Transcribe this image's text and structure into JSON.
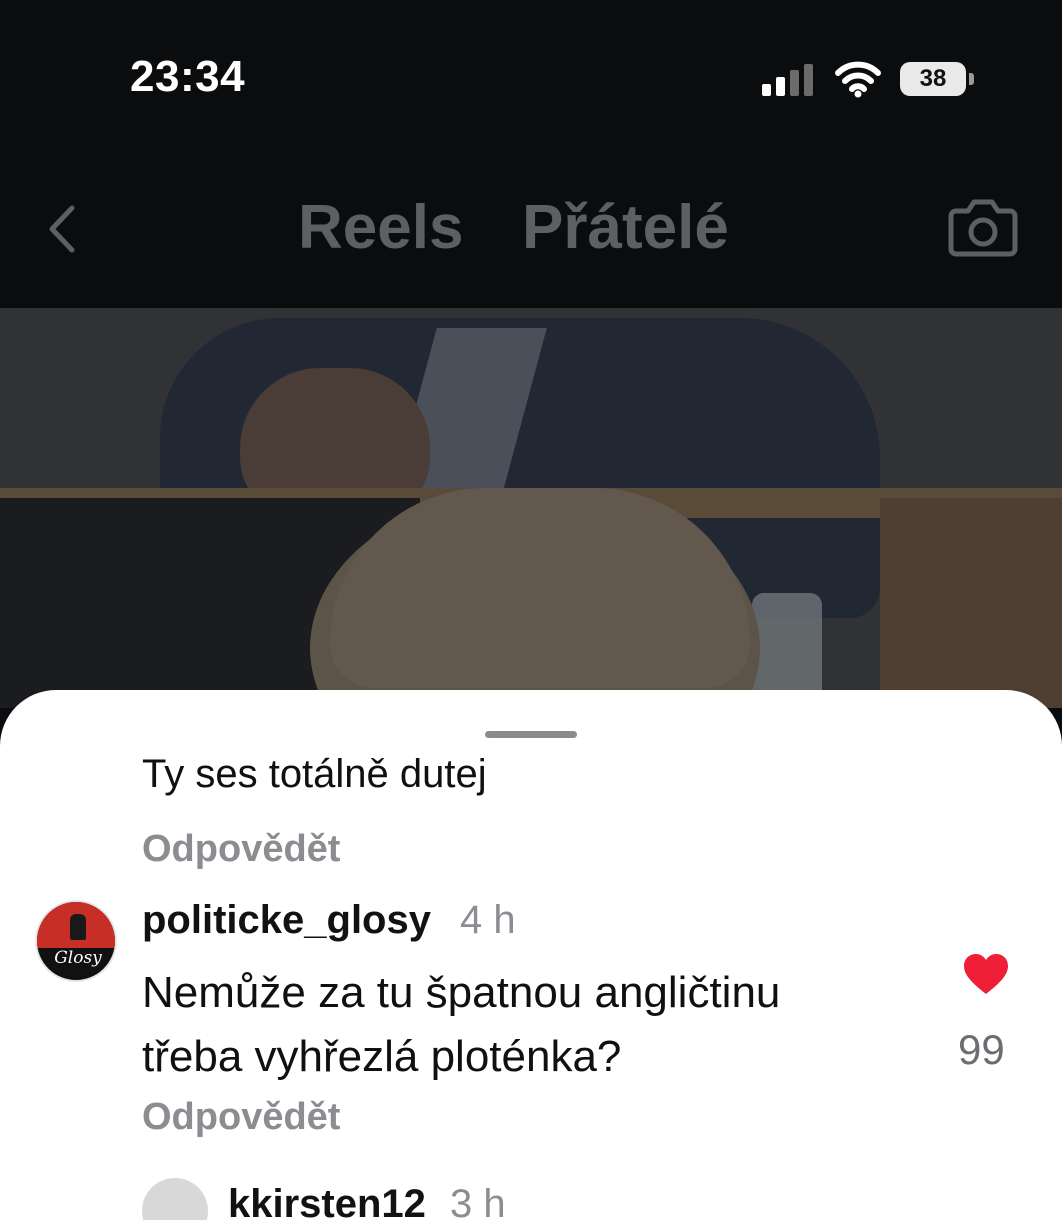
{
  "status_bar": {
    "time": "23:34",
    "battery": "38"
  },
  "header": {
    "tabs": [
      {
        "label": "Reels",
        "active": false
      },
      {
        "label": "Přátelé",
        "active": false
      }
    ]
  },
  "comments": {
    "previous_comment_text": "Ty ses totálně dutej",
    "reply_label": "Odpovědět",
    "items": [
      {
        "username": "politicke_glosy",
        "age": "4 h",
        "avatar_text": "Glosy",
        "text_lines": [
          "Nemůže za tu špatnou angličtinu",
          "třeba vyhřezlá ploténka?"
        ],
        "likes": "99",
        "liked": true
      },
      {
        "username": "kkirsten12",
        "age": "3 h"
      }
    ]
  },
  "colors": {
    "background": "#0b0c0e",
    "sheet": "#ffffff",
    "like": "#ee1f36",
    "muted": "#8b8d91"
  }
}
